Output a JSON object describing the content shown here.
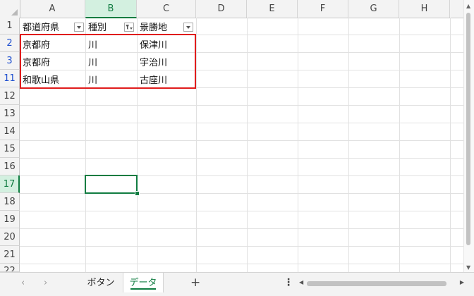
{
  "columns": [
    "A",
    "B",
    "C",
    "D",
    "E",
    "F",
    "G",
    "H"
  ],
  "selected_column": "B",
  "rows": [
    {
      "num": "1",
      "style": "normal"
    },
    {
      "num": "2",
      "style": "blue"
    },
    {
      "num": "3",
      "style": "blue"
    },
    {
      "num": "11",
      "style": "blue"
    },
    {
      "num": "12",
      "style": "normal"
    },
    {
      "num": "13",
      "style": "normal"
    },
    {
      "num": "14",
      "style": "normal"
    },
    {
      "num": "15",
      "style": "normal"
    },
    {
      "num": "16",
      "style": "normal"
    },
    {
      "num": "17",
      "style": "selected"
    },
    {
      "num": "18",
      "style": "normal"
    },
    {
      "num": "19",
      "style": "normal"
    },
    {
      "num": "20",
      "style": "normal"
    },
    {
      "num": "21",
      "style": "normal"
    },
    {
      "num": "22",
      "style": "normal"
    }
  ],
  "headers": {
    "a1": "都道府県",
    "b1": "種別",
    "c1": "景勝地"
  },
  "data_rows": [
    {
      "pref": "京都府",
      "type": "川",
      "spot": "保津川"
    },
    {
      "pref": "京都府",
      "type": "川",
      "spot": "宇治川"
    },
    {
      "pref": "和歌山県",
      "type": "川",
      "spot": "古座川"
    }
  ],
  "tabs": {
    "nav_prev": "‹",
    "nav_next": "›",
    "sheet1": "ボタン",
    "sheet2": "データ",
    "active": "データ",
    "add": "+",
    "more": "⋮"
  },
  "colors": {
    "accent": "#107c41",
    "highlight_box": "#e01c1c",
    "filtered_row_num": "#1e4fd0"
  }
}
